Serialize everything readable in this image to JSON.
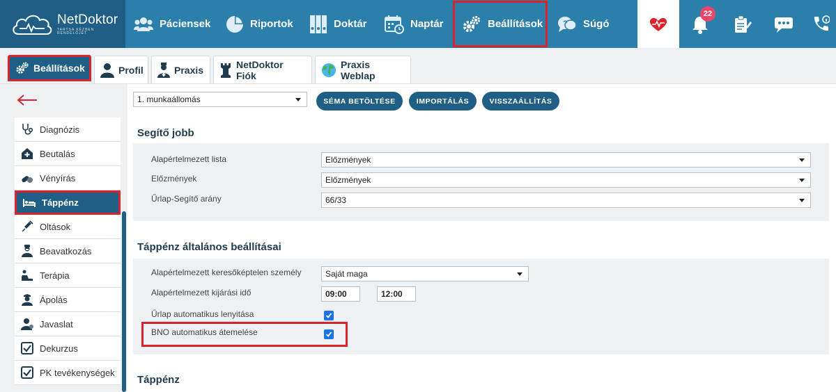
{
  "app": {
    "logo_name": "NetDoktor",
    "logo_tagline": "TARTSA KÉZBEN RENDELŐJÉT"
  },
  "nav": {
    "items": [
      {
        "label": "Páciensek",
        "icon": "users-icon"
      },
      {
        "label": "Riportok",
        "icon": "pie-chart-icon"
      },
      {
        "label": "Doktár",
        "icon": "binders-icon"
      },
      {
        "label": "Naptár",
        "icon": "calendar-icon"
      },
      {
        "label": "Beállítások",
        "icon": "gears-icon",
        "active": true
      },
      {
        "label": "Súgó",
        "icon": "help-chat-icon"
      }
    ],
    "notifications_count": "22"
  },
  "tabs": [
    {
      "label": "Beállítások",
      "icon": "gears-icon",
      "active": true
    },
    {
      "label": "Profil",
      "icon": "user-icon"
    },
    {
      "label": "Praxis",
      "icon": "doctor-icon"
    },
    {
      "label": "NetDoktor Fiók",
      "icon": "chess-rook-icon"
    },
    {
      "label": "Praxis Weblap",
      "icon": "globe-icon"
    }
  ],
  "sidebar": {
    "items": [
      {
        "label": "Diagnózis",
        "icon": "stethoscope-icon"
      },
      {
        "label": "Beutalás",
        "icon": "hospital-icon"
      },
      {
        "label": "Vényírás",
        "icon": "pills-icon"
      },
      {
        "label": "Táppénz",
        "icon": "bed-icon",
        "active": true
      },
      {
        "label": "Oltások",
        "icon": "syringe-icon"
      },
      {
        "label": "Beavatkozás",
        "icon": "surgeon-icon"
      },
      {
        "label": "Terápia",
        "icon": "therapy-icon"
      },
      {
        "label": "Ápolás",
        "icon": "nurse-icon"
      },
      {
        "label": "Javaslat",
        "icon": "user-advice-icon"
      },
      {
        "label": "Dekurzus",
        "icon": "checkbox-icon"
      },
      {
        "label": "PK tevékenységek",
        "icon": "checkbox-icon"
      }
    ]
  },
  "toolbar": {
    "workstation_value": "1. munkaállomás",
    "load_schema": "SÉMA BETÖLTÉSE",
    "import": "IMPORTÁLÁS",
    "restore": "VISSZAÁLLÍTÁS"
  },
  "helper": {
    "title": "Segítő jobb",
    "default_list_label": "Alapértelmezett lista",
    "default_list_value": "Előzmények",
    "history_label": "Előzmények",
    "history_value": "Előzmények",
    "ratio_label": "Űrlap-Segítő arány",
    "ratio_value": "66/33"
  },
  "sickpay": {
    "title": "Táppénz általános beállításai",
    "default_person_label": "Alapértelmezett keresőképtelen személy",
    "default_person_value": "Saját maga",
    "default_time_label": "Alapértelmezett kijárási idő",
    "time_from": "09:00",
    "time_to": "12:00",
    "auto_open_label": "Űrlap automatikus lenyitása",
    "auto_open_checked": true,
    "bno_label": "BNO automatikus átemelése",
    "bno_checked": true
  },
  "section3": {
    "title": "Táppénz"
  },
  "colors": {
    "nav_bg": "#2b7fab",
    "dark_blue": "#1f5f85",
    "highlight_red": "#d9232d",
    "checkbox_blue": "#1a73e8",
    "badge_pink": "#e8476a"
  }
}
